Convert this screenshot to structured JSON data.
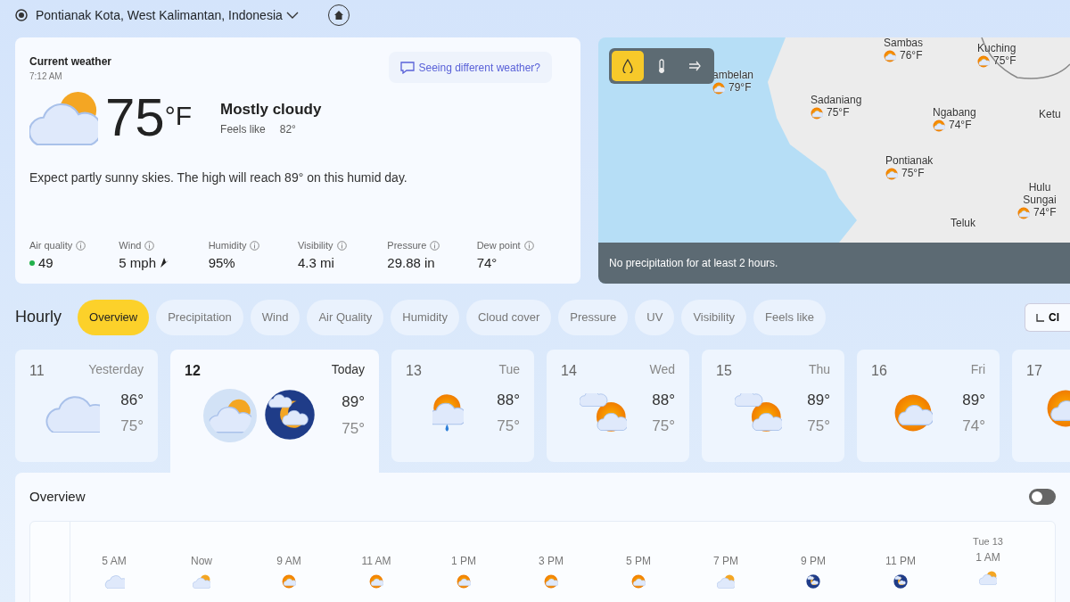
{
  "location": {
    "name": "Pontianak Kota, West Kalimantan, Indonesia"
  },
  "current": {
    "title": "Current weather",
    "time": "7:12 AM",
    "feedback": "Seeing different weather?",
    "temperature": "75",
    "unit": "°F",
    "condition": "Mostly cloudy",
    "feels_like_label": "Feels like",
    "feels_like": "82°",
    "summary": "Expect partly sunny skies. The high will reach 89° on this humid day.",
    "stats": [
      {
        "label": "Air quality",
        "value": "49",
        "color": "#22b14c",
        "kind": "dot"
      },
      {
        "label": "Wind",
        "value": "5 mph",
        "kind": "wind"
      },
      {
        "label": "Humidity",
        "value": "95%",
        "kind": "plain"
      },
      {
        "label": "Visibility",
        "value": "4.3 mi",
        "kind": "plain"
      },
      {
        "label": "Pressure",
        "value": "29.88 in",
        "kind": "plain"
      },
      {
        "label": "Dew point",
        "value": "74°",
        "kind": "plain"
      }
    ]
  },
  "map": {
    "layers": [
      {
        "kind": "precipitation",
        "selected": true
      },
      {
        "kind": "temperature",
        "selected": false
      },
      {
        "kind": "wind",
        "selected": false
      }
    ],
    "places": [
      {
        "name": "Sambas",
        "temp": "76°F"
      },
      {
        "name": "Kuching",
        "temp": "75°F"
      },
      {
        "name": "ambelan",
        "temp": "79°F"
      },
      {
        "name": "Sadaniang",
        "temp": "75°F"
      },
      {
        "name": "Ngabang",
        "temp": "74°F"
      },
      {
        "name": "Ketu"
      },
      {
        "name": "Pontianak",
        "temp": "75°F"
      },
      {
        "name": "Teluk"
      },
      {
        "name": "Hulu Sungai",
        "temp": "74°F"
      }
    ],
    "message": "No precipitation for at least 2 hours."
  },
  "hourly": {
    "title": "Hourly",
    "tabs": [
      {
        "label": "Overview",
        "selected": true
      },
      {
        "label": "Precipitation",
        "selected": false
      },
      {
        "label": "Wind",
        "selected": false
      },
      {
        "label": "Air Quality",
        "selected": false
      },
      {
        "label": "Humidity",
        "selected": false
      },
      {
        "label": "Cloud cover",
        "selected": false
      },
      {
        "label": "Pressure",
        "selected": false
      },
      {
        "label": "UV",
        "selected": false
      },
      {
        "label": "Visibility",
        "selected": false
      },
      {
        "label": "Feels like",
        "selected": false
      }
    ],
    "side_button": "Cl"
  },
  "days": [
    {
      "date": "11",
      "day": "Yesterday",
      "high": "86°",
      "low": "75°",
      "selected": false
    },
    {
      "date": "12",
      "day": "Today",
      "high": "89°",
      "low": "75°",
      "selected": true
    },
    {
      "date": "13",
      "day": "Tue",
      "high": "88°",
      "low": "75°",
      "selected": false
    },
    {
      "date": "14",
      "day": "Wed",
      "high": "88°",
      "low": "75°",
      "selected": false
    },
    {
      "date": "15",
      "day": "Thu",
      "high": "89°",
      "low": "75°",
      "selected": false
    },
    {
      "date": "16",
      "day": "Fri",
      "high": "89°",
      "low": "74°",
      "selected": false
    },
    {
      "date": "17",
      "selected": false
    }
  ],
  "overview": {
    "title": "Overview",
    "toggle_on": false,
    "hours": [
      {
        "time": "5 AM"
      },
      {
        "time": "Now"
      },
      {
        "time": "9 AM"
      },
      {
        "time": "11 AM"
      },
      {
        "time": "1 PM"
      },
      {
        "time": "3 PM"
      },
      {
        "time": "5 PM"
      },
      {
        "time": "7 PM"
      },
      {
        "time": "9 PM"
      },
      {
        "time": "11 PM"
      },
      {
        "date": "Tue 13",
        "time": "1 AM"
      }
    ]
  }
}
